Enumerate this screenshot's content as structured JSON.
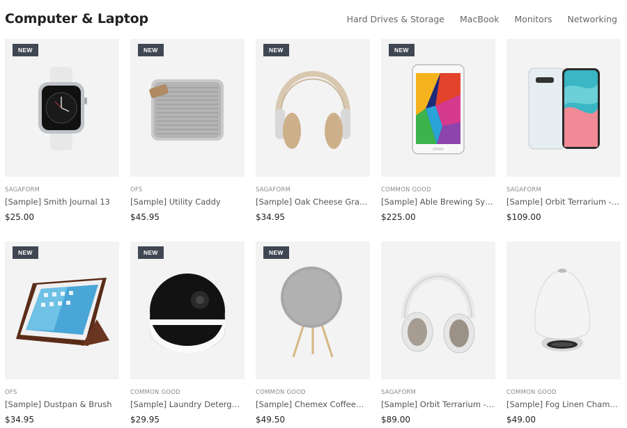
{
  "header": {
    "title": "Computer & Laptop",
    "nav": [
      "Hard Drives & Storage",
      "MacBook",
      "Monitors",
      "Networking"
    ]
  },
  "products": [
    {
      "badge": "NEW",
      "brand": "SAGAFORM",
      "name": "[Sample] Smith Journal 13",
      "price": "$25.00",
      "image": "watch"
    },
    {
      "badge": "NEW",
      "brand": "OFS",
      "name": "[Sample] Utility Caddy",
      "price": "$45.95",
      "image": "speaker-box"
    },
    {
      "badge": "NEW",
      "brand": "SAGAFORM",
      "name": "[Sample] Oak Cheese Grater",
      "price": "$34.95",
      "image": "headphones-beige"
    },
    {
      "badge": "NEW",
      "brand": "COMMON GOOD",
      "name": "[Sample] Able Brewing System",
      "price": "$225.00",
      "image": "tablet"
    },
    {
      "badge": "",
      "brand": "SAGAFORM",
      "name": "[Sample] Orbit Terrarium - Large",
      "price": "$109.00",
      "image": "phones"
    },
    {
      "badge": "NEW",
      "brand": "OFS",
      "name": "[Sample] Dustpan & Brush",
      "price": "$34.95",
      "image": "ipad-case"
    },
    {
      "badge": "NEW",
      "brand": "COMMON GOOD",
      "name": "[Sample] Laundry Detergent",
      "price": "$29.95",
      "image": "camera-orb"
    },
    {
      "badge": "NEW",
      "brand": "COMMON GOOD",
      "name": "[Sample] Chemex Coffeemake...",
      "price": "$49.50",
      "image": "speaker-stand"
    },
    {
      "badge": "",
      "brand": "SAGAFORM",
      "name": "[Sample] Orbit Terrarium - Small",
      "price": "$89.00",
      "image": "headphones-white"
    },
    {
      "badge": "",
      "brand": "COMMON GOOD",
      "name": "[Sample] Fog Linen Chambray...",
      "price": "$49.00",
      "image": "egg-speaker"
    }
  ]
}
